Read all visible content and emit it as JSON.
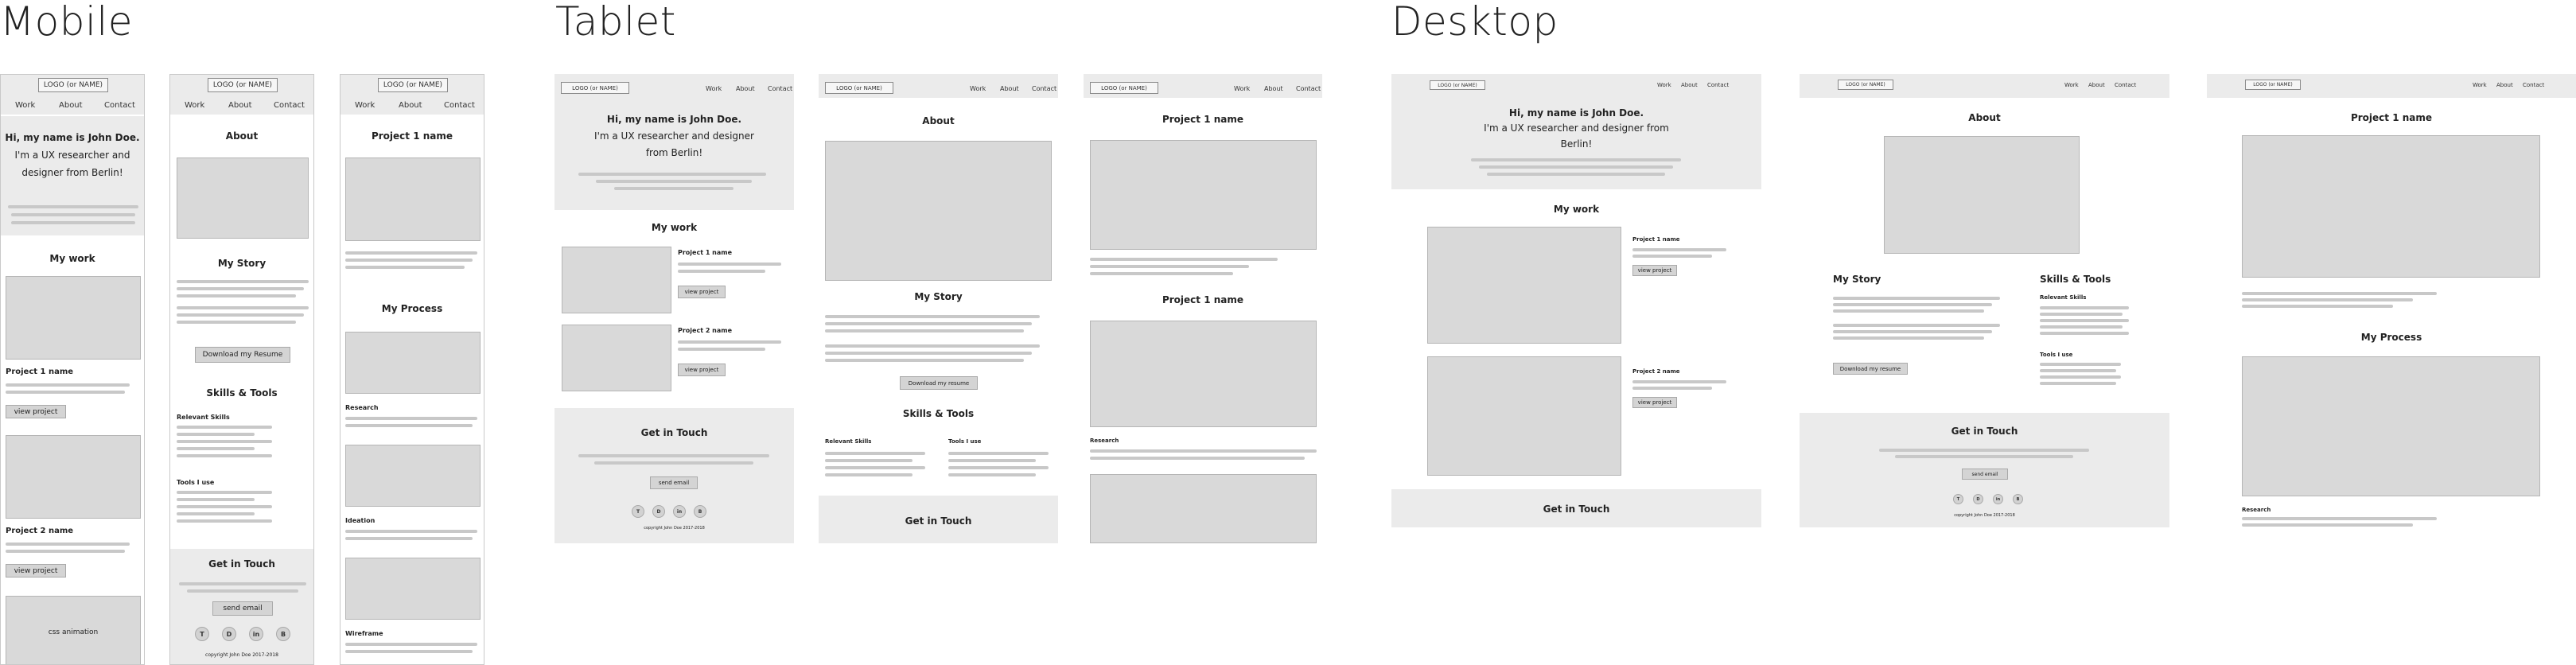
{
  "sections": {
    "mobile": "Mobile",
    "tablet": "Tablet",
    "desktop": "Desktop"
  },
  "common": {
    "logo": "LOGO (or NAME)",
    "logo_alt": "LOGO (or NAME)",
    "nav": [
      "Work",
      "About",
      "Contact"
    ],
    "hero_name": "Hi, my name is John Doe.",
    "hero_sub": "I'm a UX researcher and designer from Berlin!",
    "my_work": "My work",
    "project1": "Project 1 name",
    "project2": "Project 2 name",
    "view_project": "view project",
    "css_animation": "css animation",
    "about": "About",
    "my_story": "My Story",
    "download_resume": "Download my Resume",
    "download_resume_lc": "Download my resume",
    "skills_tools": "Skills & Tools",
    "relevant_skills": "Relevant Skills",
    "tools": "Tools I use",
    "get_in_touch": "Get in Touch",
    "send_email": "send email",
    "social": [
      "T",
      "D",
      "in",
      "B"
    ],
    "copyright": "copyright John Doe 2017-2018",
    "my_process": "My Process",
    "research": "Research",
    "ideation": "Ideation",
    "wireframe": "Wireframe"
  }
}
